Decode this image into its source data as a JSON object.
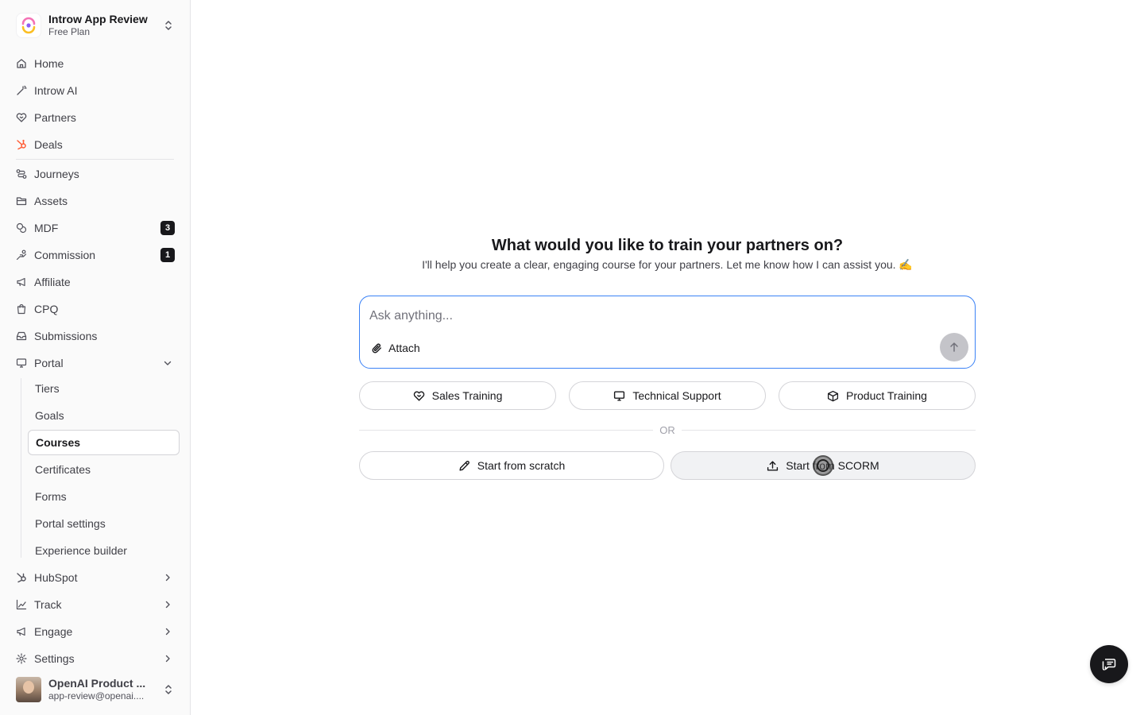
{
  "workspace": {
    "name": "Introw App Review",
    "plan": "Free Plan"
  },
  "nav": {
    "home": "Home",
    "ai": "Introw AI",
    "partners": "Partners",
    "deals": "Deals",
    "journeys": "Journeys",
    "assets": "Assets",
    "mdf": "MDF",
    "mdf_badge": "3",
    "commission": "Commission",
    "commission_badge": "1",
    "affiliate": "Affiliate",
    "cpq": "CPQ",
    "submissions": "Submissions",
    "portal": "Portal",
    "hubspot": "HubSpot",
    "track": "Track",
    "engage": "Engage",
    "settings": "Settings"
  },
  "portal_sub": {
    "tiers": "Tiers",
    "goals": "Goals",
    "courses": "Courses",
    "certificates": "Certificates",
    "forms": "Forms",
    "portal_settings": "Portal settings",
    "experience_builder": "Experience builder"
  },
  "user": {
    "name": "OpenAI Product ...",
    "email": "app-review@openai...."
  },
  "main": {
    "heading": "What would you like to train your partners on?",
    "subheading": "I'll help you create a clear, engaging course for your partners. Let me know how I can assist you. ✍️",
    "input_placeholder": "Ask anything...",
    "attach": "Attach",
    "suggestions": {
      "sales": "Sales Training",
      "technical": "Technical Support",
      "product": "Product Training"
    },
    "or": "OR",
    "scratch": "Start from scratch",
    "scorm": "Start from SCORM"
  },
  "colors": {
    "accent": "#3b82f6",
    "hubspot_orange": "#ff5c35",
    "text": "#18181b",
    "badge_bg": "#18181b"
  }
}
